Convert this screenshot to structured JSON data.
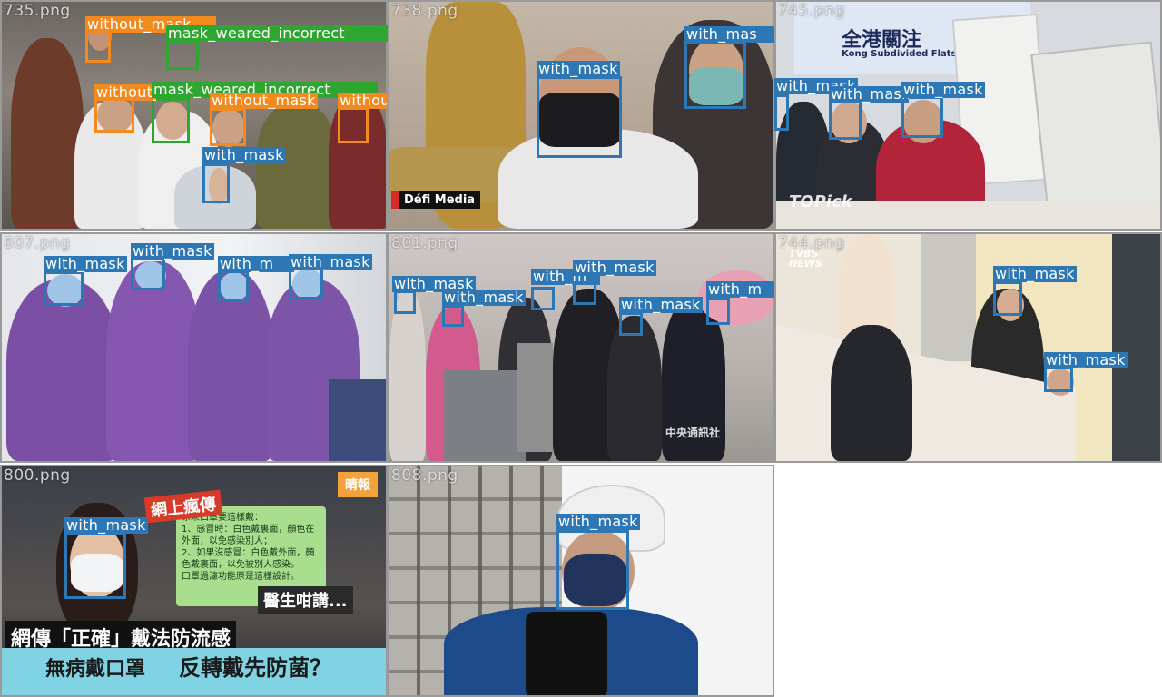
{
  "colors": {
    "with_mask": "#2d78b4",
    "without_mask": "#f28a1f",
    "mask_weared_incorrect": "#2fa62f"
  },
  "tiles": [
    {
      "file": "735.png",
      "labels": [
        "without_mask",
        "mask_weared_incorrect",
        "without_mask",
        "mask_weared_incorrect",
        "without_mask",
        "withou",
        "with_mask"
      ]
    },
    {
      "file": "738.png",
      "labels": [
        "with_mask",
        "with_mas"
      ],
      "watermark": "Défi Media"
    },
    {
      "file": "745.png",
      "labels": [
        "with_mask",
        "with_mask",
        "with_mask"
      ],
      "banner": "全港關注",
      "subbanner": "Kong Subdivided Flats C",
      "logo": "TOPick"
    },
    {
      "file": "807.png",
      "labels": [
        "with_mask",
        "with_mask",
        "with_m",
        "with_mask"
      ]
    },
    {
      "file": "801.png",
      "labels": [
        "with_mask",
        "with_mask",
        "with_m",
        "with_mask",
        "with_mask",
        "with_m"
      ],
      "logo": "中央通訊社"
    },
    {
      "file": "744.png",
      "labels": [
        "with_mask",
        "with_mask"
      ],
      "logo": "TVBS NEWS"
    },
    {
      "file": "800.png",
      "labels": [
        "with_mask"
      ],
      "tag": "網上瘋傳",
      "corner": "晴報",
      "note": "原來口罩要這樣戴：\n1、感冒時：白色戴裏面，顏色在外面，以免感染別人；\n2、如果沒感冒：白色戴外面，顏色戴裏面，以免被別人感染。\n口罩過濾功能原是這樣設計。",
      "doctor": "醫生咁講...",
      "headline1": "網傳「正確」戴法防流感",
      "headline2a": "無病戴口罩",
      "headline2b": "反轉戴先防菌？"
    },
    {
      "file": "808.png",
      "labels": [
        "with_mask"
      ]
    }
  ]
}
